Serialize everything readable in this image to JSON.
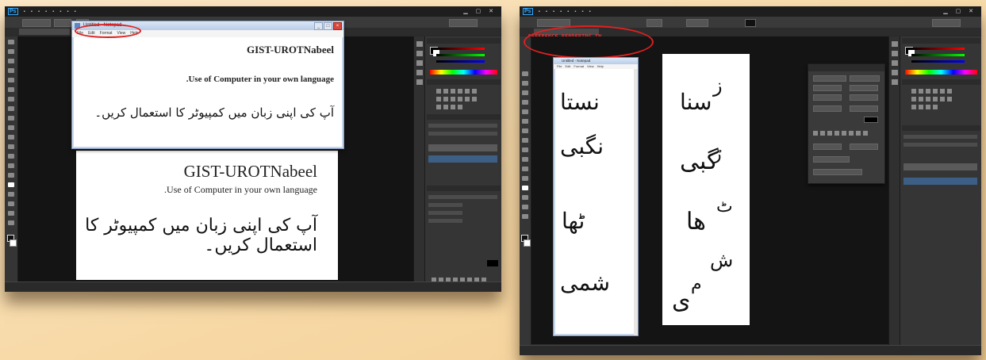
{
  "left_screenshot": {
    "notepad": {
      "title": "Untitled - Notepad",
      "menu": [
        "File",
        "Edit",
        "Format",
        "View",
        "Help"
      ],
      "line1": "GIST-UROTNabeel",
      "line2": ".Use of Computer in your own language",
      "line3": "آپ کی اپنی زبان میں کمپیوٹر کا استعمال کریں۔"
    },
    "document": {
      "title": "GIST-UROTNabeel",
      "subtitle": ".Use of Computer in your own language",
      "urdu": "آپ کی اپنی زبان میں کمپیوٹر کا استعمال کریں۔"
    }
  },
  "right_screenshot": {
    "note": "REFERENCE RENDERING IN NOTEPAD MICROSOFT",
    "notepad": {
      "title": "Untitled - Notepad",
      "words": [
        "نستا",
        "نگبی",
        "ٹھا",
        "شمی"
      ]
    },
    "document": {
      "words": [
        "ز",
        "سنا",
        "ڑ",
        "گبی",
        "ٹ",
        "ھا",
        "ش",
        "م",
        "ی"
      ]
    }
  },
  "colors": {
    "highlight_ring": "#e02020",
    "ps_blue": "#31a8ff"
  }
}
